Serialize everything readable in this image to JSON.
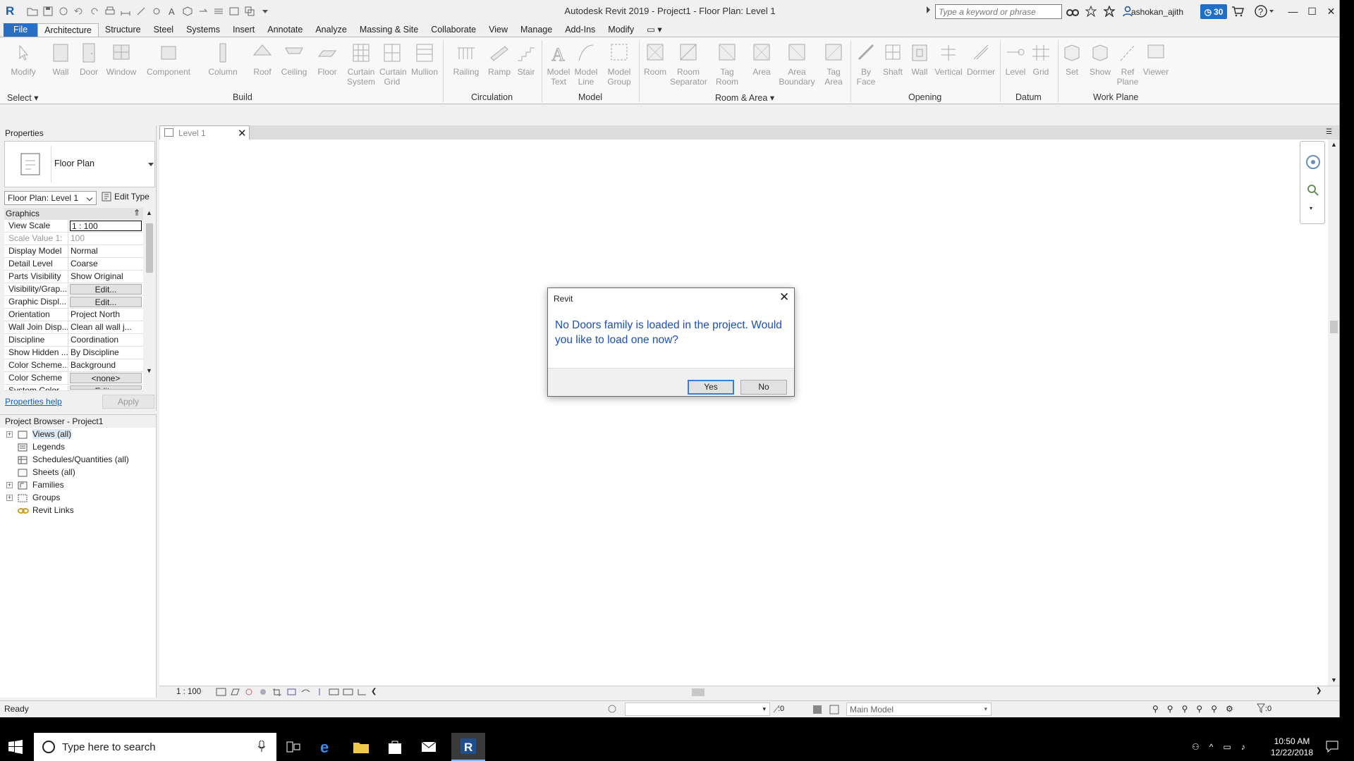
{
  "window": {
    "title": "Autodesk Revit 2019 - Project1 - Floor Plan: Level 1"
  },
  "header": {
    "search_placeholder": "Type a keyword or phrase",
    "user": "ashokan_ajith",
    "badge_count": "30",
    "icons": [
      "binoculars-icon",
      "star-network-icon",
      "star-icon",
      "user-icon",
      "clock-icon",
      "cart-icon",
      "help-icon"
    ]
  },
  "ribbon": {
    "tabs": [
      "File",
      "Architecture",
      "Structure",
      "Steel",
      "Systems",
      "Insert",
      "Annotate",
      "Analyze",
      "Massing & Site",
      "Collaborate",
      "View",
      "Manage",
      "Add-Ins",
      "Modify"
    ],
    "active_tab": "Architecture",
    "buttons": [
      "Modify",
      "Wall",
      "Door",
      "Window",
      "Component",
      "Column",
      "Roof",
      "Ceiling",
      "Floor",
      "Curtain System",
      "Curtain Grid",
      "Mullion",
      "Railing",
      "Ramp",
      "Stair",
      "Model Text",
      "Model Line",
      "Model Group",
      "Room",
      "Room Separator",
      "Tag Room",
      "Area",
      "Area Boundary",
      "Tag Area",
      "By Face",
      "Shaft",
      "Wall",
      "Vertical",
      "Dormer",
      "Level",
      "Grid",
      "Set",
      "Show",
      "Ref Plane",
      "Viewer"
    ],
    "panels": [
      "Select",
      "Build",
      "Circulation",
      "Model",
      "Room & Area",
      "Opening",
      "Datum",
      "Work Plane"
    ]
  },
  "properties": {
    "title": "Properties",
    "type_name": "Floor Plan",
    "instance": "Floor Plan: Level 1",
    "edit_type": "Edit Type",
    "section": "Graphics",
    "rows": [
      {
        "k": "View Scale",
        "v": "1 : 100"
      },
      {
        "k": "Scale Value    1:",
        "v": "100"
      },
      {
        "k": "Display Model",
        "v": "Normal"
      },
      {
        "k": "Detail Level",
        "v": "Coarse"
      },
      {
        "k": "Parts Visibility",
        "v": "Show Original"
      },
      {
        "k": "Visibility/Grap...",
        "v": "Edit..."
      },
      {
        "k": "Graphic Displ...",
        "v": "Edit..."
      },
      {
        "k": "Orientation",
        "v": "Project North"
      },
      {
        "k": "Wall Join Disp...",
        "v": "Clean all wall j..."
      },
      {
        "k": "Discipline",
        "v": "Coordination"
      },
      {
        "k": "Show Hidden ...",
        "v": "By Discipline"
      },
      {
        "k": "Color Scheme...",
        "v": "Background"
      },
      {
        "k": "Color Scheme",
        "v": "<none>"
      },
      {
        "k": "System Color ...",
        "v": "Edit..."
      }
    ],
    "help_link": "Properties help",
    "apply": "Apply"
  },
  "browser": {
    "title": "Project Browser - Project1",
    "items": [
      "Views (all)",
      "Legends",
      "Schedules/Quantities (all)",
      "Sheets (all)",
      "Families",
      "Groups",
      "Revit Links"
    ]
  },
  "view": {
    "tab_label": "Level 1",
    "scale": "1 : 100"
  },
  "dialog": {
    "title": "Revit",
    "message": "No Doors family is loaded in the project. Would you like to load one now?",
    "yes": "Yes",
    "no": "No"
  },
  "status": {
    "text": "Ready",
    "worksets_zero": ":0",
    "design_option": "Main Model",
    "filter_zero": ":0"
  },
  "taskbar": {
    "search_placeholder": "Type here to search",
    "time": "10:50 AM",
    "date": "12/22/2018"
  },
  "colors": {
    "accent": "#2a6dc4",
    "dialog_text": "#1a4fb8",
    "badge": "#1e6fc8"
  }
}
